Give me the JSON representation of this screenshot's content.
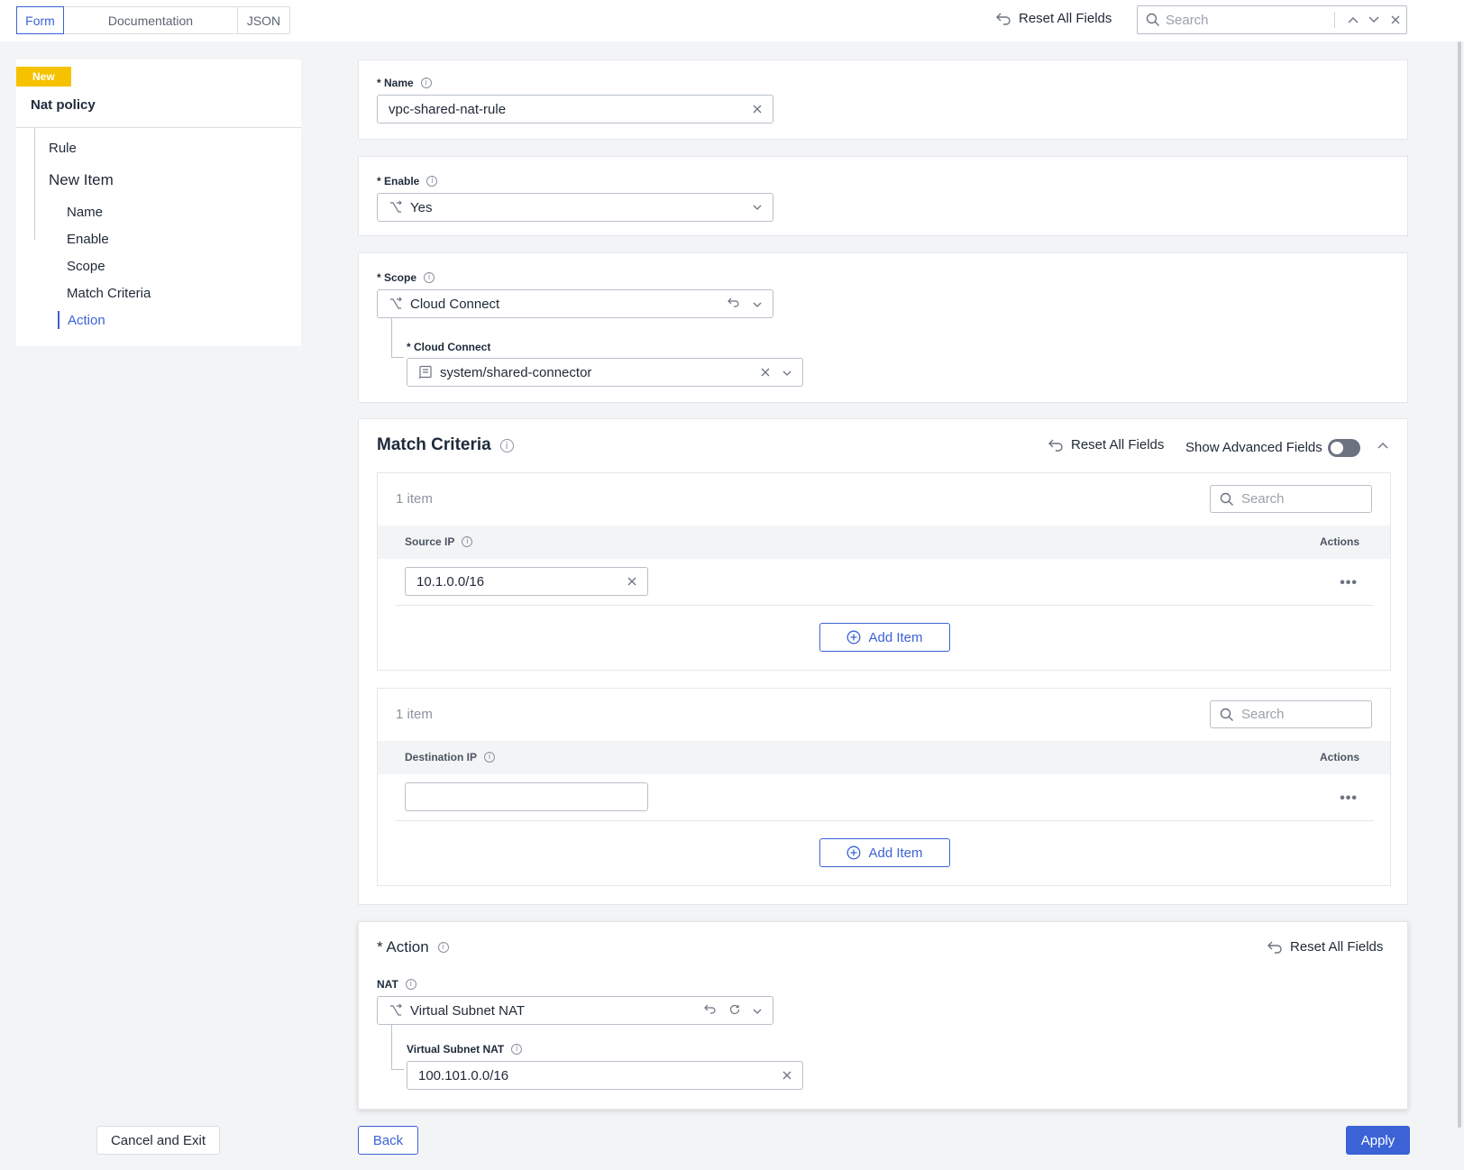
{
  "tabs": [
    {
      "label": "Form"
    },
    {
      "label": "Documentation"
    },
    {
      "label": "JSON"
    }
  ],
  "topbar": {
    "reset_label": "Reset All Fields",
    "search_placeholder": "Search"
  },
  "sidebar": {
    "badge": "New",
    "title": "Nat policy",
    "items": [
      {
        "label": "Rule"
      },
      {
        "label": "New Item"
      },
      {
        "label": "Name"
      },
      {
        "label": "Enable"
      },
      {
        "label": "Scope"
      },
      {
        "label": "Match Criteria"
      },
      {
        "label": "Action"
      }
    ]
  },
  "name_card": {
    "label": "* Name",
    "value": "vpc-shared-nat-rule"
  },
  "enable_card": {
    "label": "* Enable",
    "value": "Yes"
  },
  "scope_card": {
    "label": "* Scope",
    "value": "Cloud Connect",
    "sub_label": "* Cloud Connect",
    "sub_value": "system/shared-connector"
  },
  "match": {
    "title": "Match Criteria",
    "reset_label": "Reset All Fields",
    "advanced_label": "Show Advanced Fields",
    "advanced_on": false,
    "source": {
      "count": "1 item",
      "search_placeholder": "Search",
      "column": "Source IP",
      "actions": "Actions",
      "row_value": "10.1.0.0/16",
      "add_label": "Add Item"
    },
    "destination": {
      "count": "1 item",
      "search_placeholder": "Search",
      "column": "Destination IP",
      "actions": "Actions",
      "row_value": "",
      "add_label": "Add Item"
    }
  },
  "action": {
    "title": "* Action",
    "reset_label": "Reset All Fields",
    "nat_label": "NAT",
    "nat_value": "Virtual Subnet NAT",
    "sub_label": "Virtual Subnet NAT",
    "sub_value": "100.101.0.0/16"
  },
  "footer": {
    "cancel": "Cancel and Exit",
    "back": "Back",
    "apply": "Apply"
  },
  "colors": {
    "accent": "#3b63d6",
    "badge": "#f6c200"
  }
}
